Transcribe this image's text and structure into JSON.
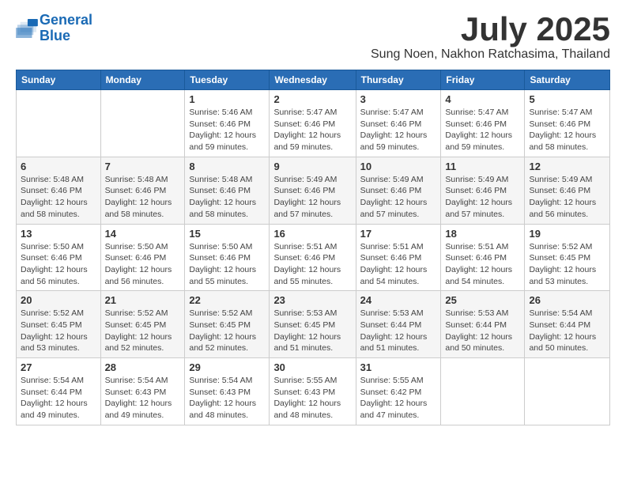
{
  "logo": {
    "line1": "General",
    "line2": "Blue"
  },
  "title": "July 2025",
  "location": "Sung Noen, Nakhon Ratchasima, Thailand",
  "days_of_week": [
    "Sunday",
    "Monday",
    "Tuesday",
    "Wednesday",
    "Thursday",
    "Friday",
    "Saturday"
  ],
  "weeks": [
    [
      {
        "day": "",
        "info": ""
      },
      {
        "day": "",
        "info": ""
      },
      {
        "day": "1",
        "info": "Sunrise: 5:46 AM\nSunset: 6:46 PM\nDaylight: 12 hours and 59 minutes."
      },
      {
        "day": "2",
        "info": "Sunrise: 5:47 AM\nSunset: 6:46 PM\nDaylight: 12 hours and 59 minutes."
      },
      {
        "day": "3",
        "info": "Sunrise: 5:47 AM\nSunset: 6:46 PM\nDaylight: 12 hours and 59 minutes."
      },
      {
        "day": "4",
        "info": "Sunrise: 5:47 AM\nSunset: 6:46 PM\nDaylight: 12 hours and 59 minutes."
      },
      {
        "day": "5",
        "info": "Sunrise: 5:47 AM\nSunset: 6:46 PM\nDaylight: 12 hours and 58 minutes."
      }
    ],
    [
      {
        "day": "6",
        "info": "Sunrise: 5:48 AM\nSunset: 6:46 PM\nDaylight: 12 hours and 58 minutes."
      },
      {
        "day": "7",
        "info": "Sunrise: 5:48 AM\nSunset: 6:46 PM\nDaylight: 12 hours and 58 minutes."
      },
      {
        "day": "8",
        "info": "Sunrise: 5:48 AM\nSunset: 6:46 PM\nDaylight: 12 hours and 58 minutes."
      },
      {
        "day": "9",
        "info": "Sunrise: 5:49 AM\nSunset: 6:46 PM\nDaylight: 12 hours and 57 minutes."
      },
      {
        "day": "10",
        "info": "Sunrise: 5:49 AM\nSunset: 6:46 PM\nDaylight: 12 hours and 57 minutes."
      },
      {
        "day": "11",
        "info": "Sunrise: 5:49 AM\nSunset: 6:46 PM\nDaylight: 12 hours and 57 minutes."
      },
      {
        "day": "12",
        "info": "Sunrise: 5:49 AM\nSunset: 6:46 PM\nDaylight: 12 hours and 56 minutes."
      }
    ],
    [
      {
        "day": "13",
        "info": "Sunrise: 5:50 AM\nSunset: 6:46 PM\nDaylight: 12 hours and 56 minutes."
      },
      {
        "day": "14",
        "info": "Sunrise: 5:50 AM\nSunset: 6:46 PM\nDaylight: 12 hours and 56 minutes."
      },
      {
        "day": "15",
        "info": "Sunrise: 5:50 AM\nSunset: 6:46 PM\nDaylight: 12 hours and 55 minutes."
      },
      {
        "day": "16",
        "info": "Sunrise: 5:51 AM\nSunset: 6:46 PM\nDaylight: 12 hours and 55 minutes."
      },
      {
        "day": "17",
        "info": "Sunrise: 5:51 AM\nSunset: 6:46 PM\nDaylight: 12 hours and 54 minutes."
      },
      {
        "day": "18",
        "info": "Sunrise: 5:51 AM\nSunset: 6:46 PM\nDaylight: 12 hours and 54 minutes."
      },
      {
        "day": "19",
        "info": "Sunrise: 5:52 AM\nSunset: 6:45 PM\nDaylight: 12 hours and 53 minutes."
      }
    ],
    [
      {
        "day": "20",
        "info": "Sunrise: 5:52 AM\nSunset: 6:45 PM\nDaylight: 12 hours and 53 minutes."
      },
      {
        "day": "21",
        "info": "Sunrise: 5:52 AM\nSunset: 6:45 PM\nDaylight: 12 hours and 52 minutes."
      },
      {
        "day": "22",
        "info": "Sunrise: 5:52 AM\nSunset: 6:45 PM\nDaylight: 12 hours and 52 minutes."
      },
      {
        "day": "23",
        "info": "Sunrise: 5:53 AM\nSunset: 6:45 PM\nDaylight: 12 hours and 51 minutes."
      },
      {
        "day": "24",
        "info": "Sunrise: 5:53 AM\nSunset: 6:44 PM\nDaylight: 12 hours and 51 minutes."
      },
      {
        "day": "25",
        "info": "Sunrise: 5:53 AM\nSunset: 6:44 PM\nDaylight: 12 hours and 50 minutes."
      },
      {
        "day": "26",
        "info": "Sunrise: 5:54 AM\nSunset: 6:44 PM\nDaylight: 12 hours and 50 minutes."
      }
    ],
    [
      {
        "day": "27",
        "info": "Sunrise: 5:54 AM\nSunset: 6:44 PM\nDaylight: 12 hours and 49 minutes."
      },
      {
        "day": "28",
        "info": "Sunrise: 5:54 AM\nSunset: 6:43 PM\nDaylight: 12 hours and 49 minutes."
      },
      {
        "day": "29",
        "info": "Sunrise: 5:54 AM\nSunset: 6:43 PM\nDaylight: 12 hours and 48 minutes."
      },
      {
        "day": "30",
        "info": "Sunrise: 5:55 AM\nSunset: 6:43 PM\nDaylight: 12 hours and 48 minutes."
      },
      {
        "day": "31",
        "info": "Sunrise: 5:55 AM\nSunset: 6:42 PM\nDaylight: 12 hours and 47 minutes."
      },
      {
        "day": "",
        "info": ""
      },
      {
        "day": "",
        "info": ""
      }
    ]
  ]
}
